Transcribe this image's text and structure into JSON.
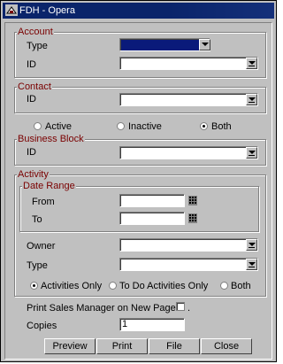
{
  "window": {
    "title": "FDH - Opera"
  },
  "account": {
    "section_title": "Account",
    "type_label": "Type",
    "id_label": "ID",
    "type_value": "",
    "id_value": ""
  },
  "contact": {
    "section_title": "Contact",
    "id_label": "ID",
    "id_value": ""
  },
  "status_filter": {
    "options": [
      "Active",
      "Inactive",
      "Both"
    ],
    "selected": "Both"
  },
  "business_block": {
    "section_title": "Business Block",
    "id_label": "ID",
    "id_value": ""
  },
  "activity": {
    "section_title": "Activity",
    "date_range": {
      "title": "Date Range",
      "from_label": "From",
      "to_label": "To",
      "from_value": "",
      "to_value": ""
    },
    "owner_label": "Owner",
    "type_label": "Type",
    "owner_value": "",
    "type_value": "",
    "scope_options": [
      "Activities Only",
      "To Do Activities Only",
      "Both"
    ],
    "scope_selected": "Activities Only"
  },
  "print_sales_manager": {
    "label": "Print Sales Manager on New Page",
    "checked": false,
    "suffix": "."
  },
  "copies": {
    "label": "Copies",
    "value": "1"
  },
  "buttons": {
    "preview": "Preview",
    "print": "Print",
    "file": "File",
    "close": "Close"
  }
}
